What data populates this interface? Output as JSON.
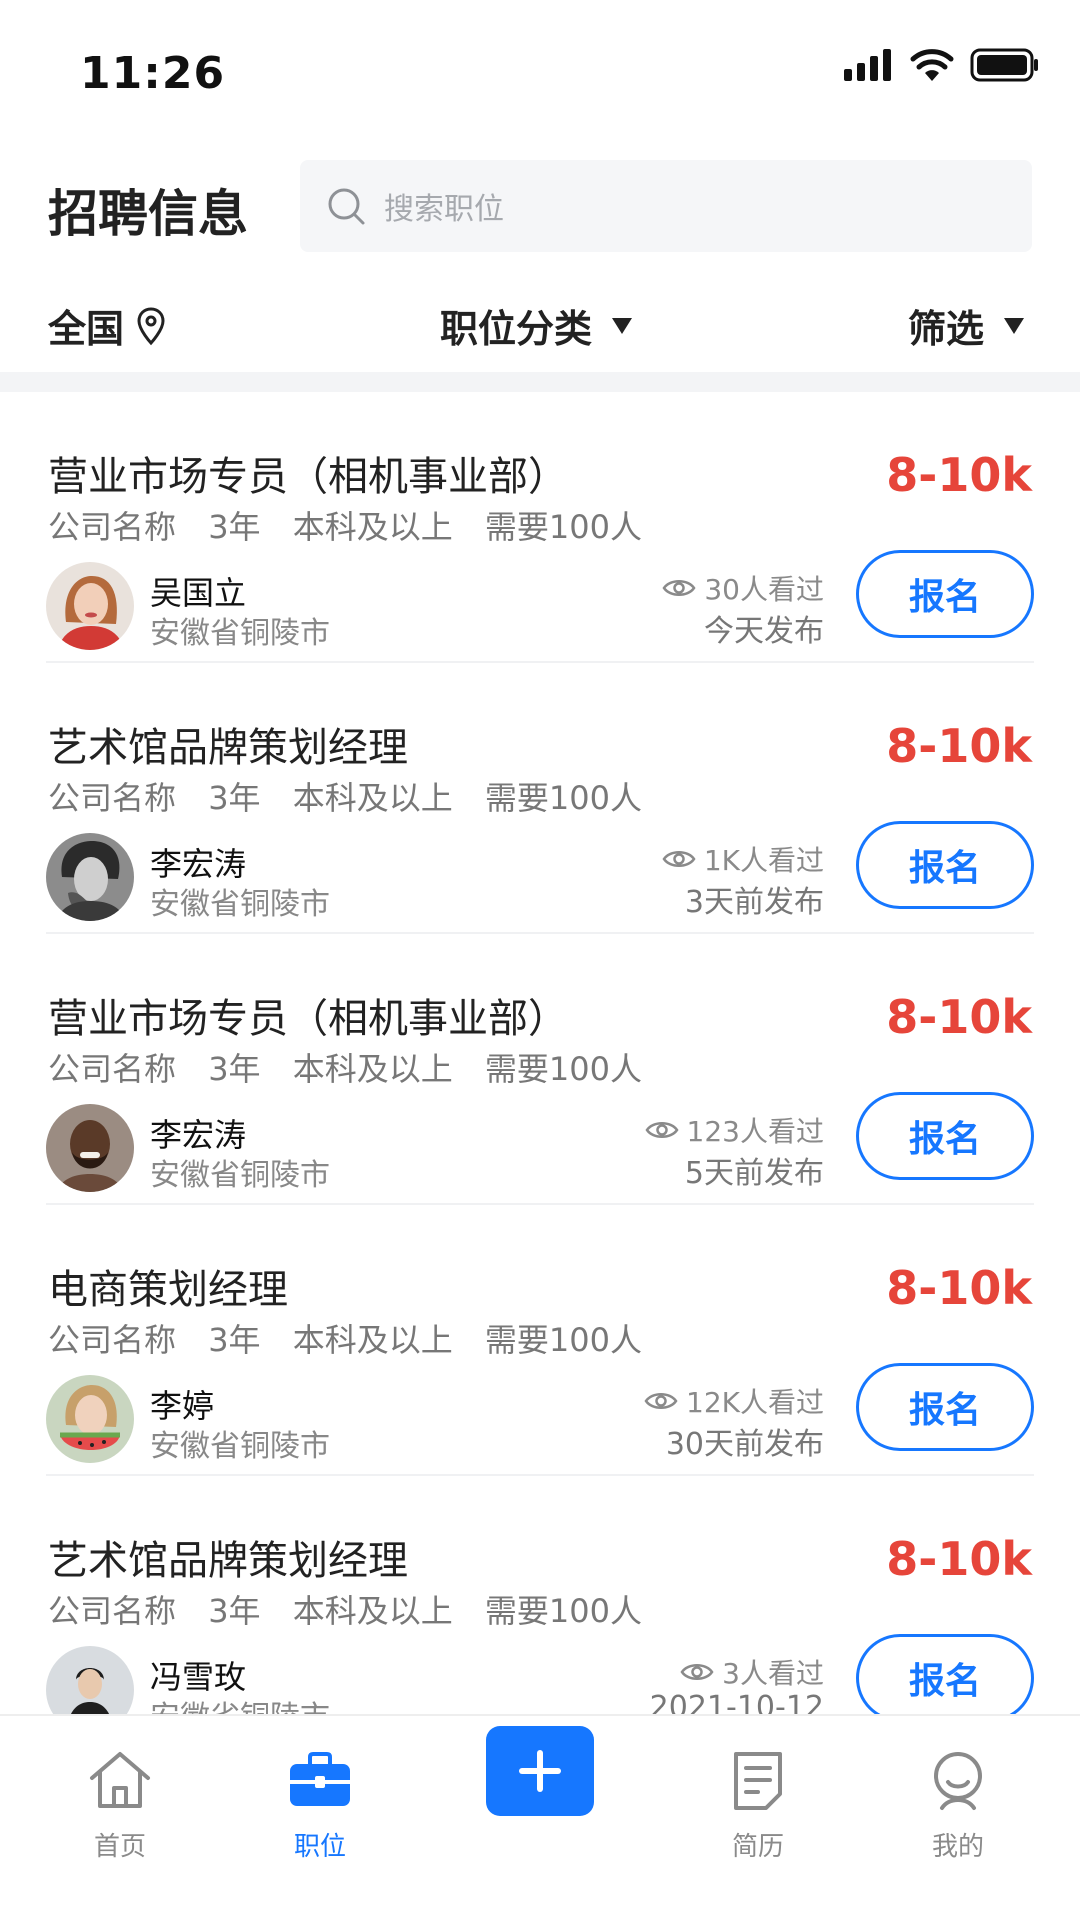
{
  "status_bar": {
    "time": "11:26"
  },
  "header": {
    "title": "招聘信息",
    "search_placeholder": "搜索职位"
  },
  "filters": {
    "region": "全国",
    "category": "职位分类",
    "screen": "筛选"
  },
  "colors": {
    "accent": "#1677ff",
    "salary": "#e6453a"
  },
  "jobs": [
    {
      "title": "营业市场专员（相机事业部）",
      "salary": "8-10k",
      "company": "公司名称",
      "experience": "3年",
      "education": "本科及以上",
      "headcount": "需要100人",
      "poster": "吴国立",
      "location": "安徽省铜陵市",
      "views": "30人看过",
      "posted": "今天发布",
      "apply": "报名",
      "avatar": "woman-red-hair"
    },
    {
      "title": "艺术馆品牌策划经理",
      "salary": "8-10k",
      "company": "公司名称",
      "experience": "3年",
      "education": "本科及以上",
      "headcount": "需要100人",
      "poster": "李宏涛",
      "location": "安徽省铜陵市",
      "views": "1K人看过",
      "posted": "3天前发布",
      "apply": "报名",
      "avatar": "man-monochrome"
    },
    {
      "title": "营业市场专员（相机事业部）",
      "salary": "8-10k",
      "company": "公司名称",
      "experience": "3年",
      "education": "本科及以上",
      "headcount": "需要100人",
      "poster": "李宏涛",
      "location": "安徽省铜陵市",
      "views": "123人看过",
      "posted": "5天前发布",
      "apply": "报名",
      "avatar": "man-smiling-beard"
    },
    {
      "title": "电商策划经理",
      "salary": "8-10k",
      "company": "公司名称",
      "experience": "3年",
      "education": "本科及以上",
      "headcount": "需要100人",
      "poster": "李婷",
      "location": "安徽省铜陵市",
      "views": "12K人看过",
      "posted": "30天前发布",
      "apply": "报名",
      "avatar": "woman-watermelon"
    },
    {
      "title": "艺术馆品牌策划经理",
      "salary": "8-10k",
      "company": "公司名称",
      "experience": "3年",
      "education": "本科及以上",
      "headcount": "需要100人",
      "poster": "冯雪玫",
      "location": "安徽省铜陵市",
      "views": "3人看过",
      "posted": "2021-10-12",
      "apply": "报名",
      "avatar": "man-dark-clothes"
    }
  ],
  "tabs": [
    {
      "label": "首页",
      "icon": "home-icon",
      "active": false
    },
    {
      "label": "职位",
      "icon": "briefcase-icon",
      "active": true
    },
    {
      "label": "",
      "icon": "plus-icon",
      "active": false
    },
    {
      "label": "简历",
      "icon": "resume-icon",
      "active": false
    },
    {
      "label": "我的",
      "icon": "profile-icon",
      "active": false
    }
  ]
}
